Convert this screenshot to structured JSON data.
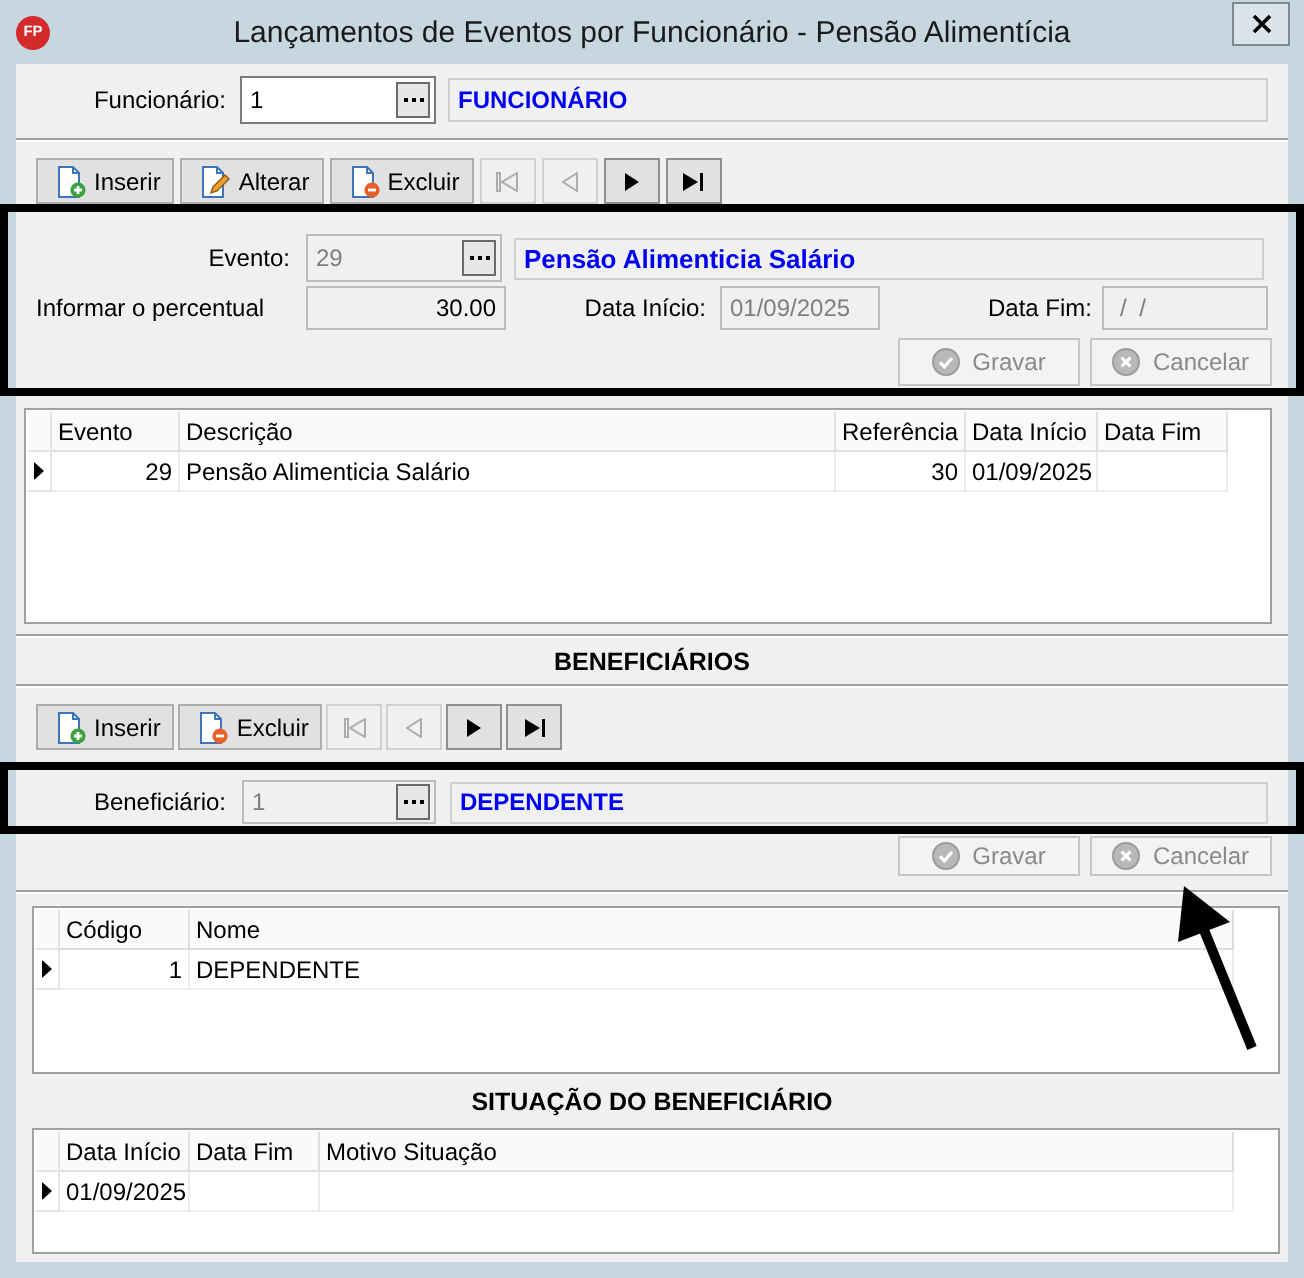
{
  "window": {
    "logo": "FP",
    "title": "Lançamentos de Eventos por Funcionário - Pensão Alimentícia"
  },
  "employee": {
    "label": "Funcionário:",
    "code": {
      "lookup": true,
      "value": "1",
      "disabled": false,
      "readonly": false
    },
    "name": "FUNCIONÁRIO"
  },
  "events_toolbar": {
    "actions": [
      {
        "kind": "insert",
        "label": "Inserir"
      },
      {
        "kind": "edit",
        "label": "Alterar"
      },
      {
        "kind": "delete",
        "label": "Excluir"
      }
    ],
    "nav": [
      {
        "kind": "first",
        "disabled": true
      },
      {
        "kind": "prev",
        "disabled": true
      },
      {
        "kind": "next",
        "disabled": false
      },
      {
        "kind": "last",
        "disabled": false
      }
    ]
  },
  "event_form": {
    "highlighted": true,
    "event": {
      "label": "Evento:",
      "lookup": true,
      "value": "29",
      "disabled": true,
      "readonly": true,
      "name": "Pensão Alimenticia Salário"
    },
    "percent": {
      "label": "Informar o percentual",
      "numeric": true,
      "value": "30.00",
      "disabled": false,
      "readonly": true
    },
    "start_date": {
      "label": "Data Início:",
      "value": "01/09/2025",
      "disabled": true,
      "readonly": true
    },
    "end_date": {
      "label": "Data Fim:",
      "value": "/ /",
      "disabled": true,
      "readonly": true
    },
    "buttons": [
      {
        "kind": "save",
        "label": "Gravar",
        "disabled": true
      },
      {
        "kind": "cancel",
        "label": "Cancelar",
        "disabled": true
      }
    ]
  },
  "events_grid": {
    "columns": [
      "Evento",
      "Descrição",
      "Referência",
      "Data Início",
      "Data Fim"
    ],
    "rows": [
      {
        "selected": true,
        "cells": [
          "29",
          "Pensão Alimenticia Salário",
          "30",
          "01/09/2025",
          null
        ]
      }
    ]
  },
  "beneficiaries": {
    "heading": "BENEFICIÁRIOS",
    "toolbar": {
      "actions": [
        {
          "kind": "insert",
          "label": "Inserir"
        },
        {
          "kind": "delete",
          "label": "Excluir"
        }
      ],
      "nav": [
        {
          "kind": "first",
          "disabled": true
        },
        {
          "kind": "prev",
          "disabled": true
        },
        {
          "kind": "next",
          "disabled": false
        },
        {
          "kind": "last",
          "disabled": false
        }
      ]
    },
    "form": {
      "highlighted": true,
      "beneficiary": {
        "label": "Beneficiário:",
        "lookup": true,
        "value": "1",
        "disabled": true,
        "readonly": true,
        "name": "DEPENDENTE"
      },
      "buttons": [
        {
          "kind": "save",
          "label": "Gravar",
          "disabled": true
        },
        {
          "kind": "cancel",
          "label": "Cancelar",
          "disabled": true
        }
      ]
    },
    "grid": {
      "columns": [
        "Código",
        "Nome"
      ],
      "rows": [
        {
          "selected": true,
          "cells": [
            "1",
            "DEPENDENTE"
          ]
        }
      ]
    }
  },
  "beneficiary_status": {
    "heading": "SITUAÇÃO DO BENEFICIÁRIO",
    "grid": {
      "columns": [
        "Data Início",
        "Data Fim",
        "Motivo Situação"
      ],
      "rows": [
        {
          "selected": true,
          "cells": [
            "01/09/2025",
            null,
            null
          ]
        }
      ]
    }
  }
}
